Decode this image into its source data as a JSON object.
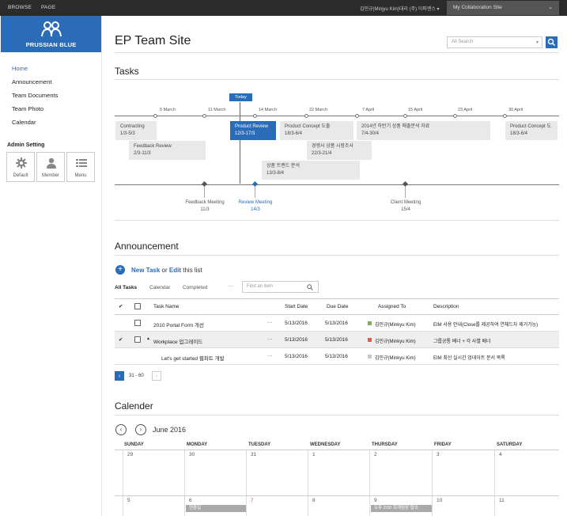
{
  "topbar": {
    "browse": "BROWSE",
    "page": "PAGE",
    "user": "김민규(Minjyu Kim)대리 (주) 이파엔스 ▾",
    "site_dropdown": "My Collaboration Site"
  },
  "logo": {
    "label": "PRUSSIAN BLUE"
  },
  "nav": [
    "Home",
    "Announcement",
    "Team Documents",
    "Team Photo",
    "Calendar"
  ],
  "admin": {
    "title": "Admin Setting",
    "tiles": [
      {
        "label": "Default",
        "icon": "gear-icon"
      },
      {
        "label": "Member",
        "icon": "person-icon"
      },
      {
        "label": "Menu",
        "icon": "menu-icon"
      }
    ]
  },
  "site_title": "EP Team Site",
  "search": {
    "placeholder": "All Search"
  },
  "tasks": {
    "heading": "Tasks",
    "today": "Today",
    "ticks": [
      "5 March",
      "11 March",
      "14 March",
      "22 March",
      "7 April",
      "15 April",
      "23 April",
      "30 April"
    ],
    "boxes": [
      {
        "title": "Contracting",
        "dates": "1/3-5/3"
      },
      {
        "title": "Feedback Review",
        "dates": "2/3-11/3"
      },
      {
        "title": "Product Review",
        "dates": "12/3-17/3"
      },
      {
        "title": "Product Concept 도출",
        "dates": "18/3-6/4"
      },
      {
        "title": "경쟁사 상품 시장조사",
        "dates": "22/3-21/4"
      },
      {
        "title": "상품 트렌드 분석",
        "dates": "13/3-8/4"
      },
      {
        "title": "2014년 하반기 상품 매출분석 자료",
        "dates": "7/4-30/4"
      },
      {
        "title": "Product Concept 도",
        "dates": "18/3-6/4"
      }
    ],
    "milestones": [
      {
        "title": "Feedback Meeting",
        "date": "11/3"
      },
      {
        "title": "Review Meeting",
        "date": "14/3"
      },
      {
        "title": "Client Meeting",
        "date": "15/4"
      }
    ]
  },
  "announcement": {
    "heading": "Announcement",
    "new_task": "New Task",
    "or": "or",
    "edit": "Edit",
    "this_list": "this list",
    "tabs": [
      "All Tasks",
      "Calendar",
      "Completed"
    ],
    "more": "···",
    "find_placeholder": "Find an item",
    "columns": [
      "Task Name",
      "Start Date",
      "Due Date",
      "Assigned To",
      "Description"
    ],
    "rows": [
      {
        "name": "2010 Portal Form 개선",
        "start": "5/13/2016",
        "due": "5/13/2016",
        "assigned": "김민규(Minkyu Kim)",
        "color": "#7ab648",
        "desc": "EIM 사용 안내(Close를 제공하여 연체드자 제거가능)",
        "ellipsis": "···"
      },
      {
        "name": "Workplace 업그레이드",
        "start": "5/13/2016",
        "due": "5/13/2016",
        "assigned": "김민규(Minkyu Kim)",
        "color": "#e05a4a",
        "desc": "그룹공통 배너 + 각 사별 배너",
        "ellipsis": "···"
      },
      {
        "name": "Let's get started 웹파트 개발",
        "start": "5/13/2016",
        "due": "5/13/2016",
        "assigned": "김민규(Minkyu Kim)",
        "color": "#c8c8c8",
        "desc": "EIM 최신 실시간 업데이트 문서 목록",
        "ellipsis": "···"
      }
    ],
    "pager": {
      "range": "31 - 60",
      "prev": "‹",
      "next": "›"
    }
  },
  "calendar": {
    "heading": "Calender",
    "month": "June 2016",
    "prev": "‹",
    "next": "›",
    "days": [
      "SUNDAY",
      "MONDAY",
      "TUESDAY",
      "WEDNESDAY",
      "THURSDAY",
      "FRIDAY",
      "SATURDAY"
    ],
    "week1": [
      "29",
      "30",
      "31",
      "1",
      "2",
      "3",
      "4"
    ],
    "week2": [
      "5",
      "6",
      "7",
      "8",
      "9",
      "10",
      "11"
    ],
    "events": [
      {
        "label": "현충일"
      },
      {
        "label": "오후 3:00 회계팀장 협의"
      }
    ]
  },
  "colors": {
    "accent": "#2b6cb8",
    "topbar": "#2b2b2b"
  }
}
